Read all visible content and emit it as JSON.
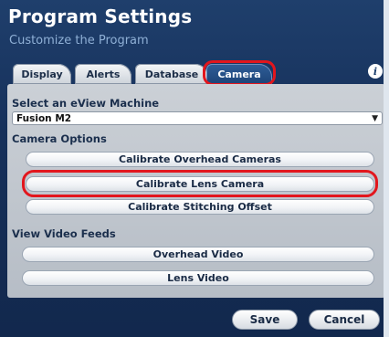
{
  "window": {
    "title": "Program Settings",
    "subtitle": "Customize the Program"
  },
  "tabs": [
    {
      "label": "Display",
      "active": false
    },
    {
      "label": "Alerts",
      "active": false
    },
    {
      "label": "Database",
      "active": false
    },
    {
      "label": "Camera",
      "active": true
    }
  ],
  "info_button": {
    "label": "i"
  },
  "machine": {
    "section_label": "Select an eView Machine",
    "selected_value": "Fusion M2"
  },
  "camera_options": {
    "section_label": "Camera Options",
    "buttons": [
      {
        "label": "Calibrate Overhead Cameras"
      },
      {
        "label": "Calibrate Lens Camera"
      },
      {
        "label": "Calibrate Stitching Offset"
      }
    ]
  },
  "video_feeds": {
    "section_label": "View Video Feeds",
    "buttons": [
      {
        "label": "Overhead Video"
      },
      {
        "label": "Lens Video"
      }
    ]
  },
  "footer": {
    "save_label": "Save",
    "cancel_label": "Cancel"
  },
  "colors": {
    "window_bg": "#1a3763",
    "highlight": "#e2161d",
    "active_tab": "#2a5890"
  }
}
